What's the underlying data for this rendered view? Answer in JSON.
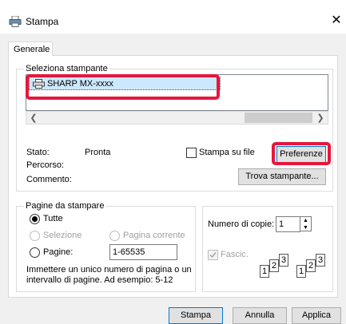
{
  "window": {
    "title": "Stampa",
    "close_glyph": "✕"
  },
  "tabs": [
    {
      "label": "Generale"
    }
  ],
  "printer_group": {
    "label": "Seleziona stampante",
    "printers": [
      {
        "name": "SHARP MX-xxxx",
        "icon": "printer-icon"
      }
    ]
  },
  "status": {
    "stato_label": "Stato:",
    "stato_value": "Pronta",
    "percorso_label": "Percorso:",
    "commento_label": "Commento:"
  },
  "print_to_file": {
    "label": "Stampa su file",
    "checked": false
  },
  "buttons": {
    "preferences": "Preferenze",
    "find_printer": "Trova stampante...",
    "print": "Stampa",
    "cancel": "Annulla",
    "apply": "Applica"
  },
  "page_range": {
    "label": "Pagine da stampare",
    "all": "Tutte",
    "selection": "Selezione",
    "current": "Pagina corrente",
    "pages": "Pagine:",
    "pages_value": "1-65535",
    "hint": "Immettere un unico numero di pagina o un intervallo di pagine. Ad esempio: 5-12"
  },
  "copies": {
    "label": "Numero di copie:",
    "value": "1",
    "collate": "Fascic.",
    "collate_checked": true,
    "collate_disabled": true
  },
  "colors": {
    "highlight": "#e5173b",
    "selection": "#cce8ff",
    "accent": "#0078d7"
  }
}
